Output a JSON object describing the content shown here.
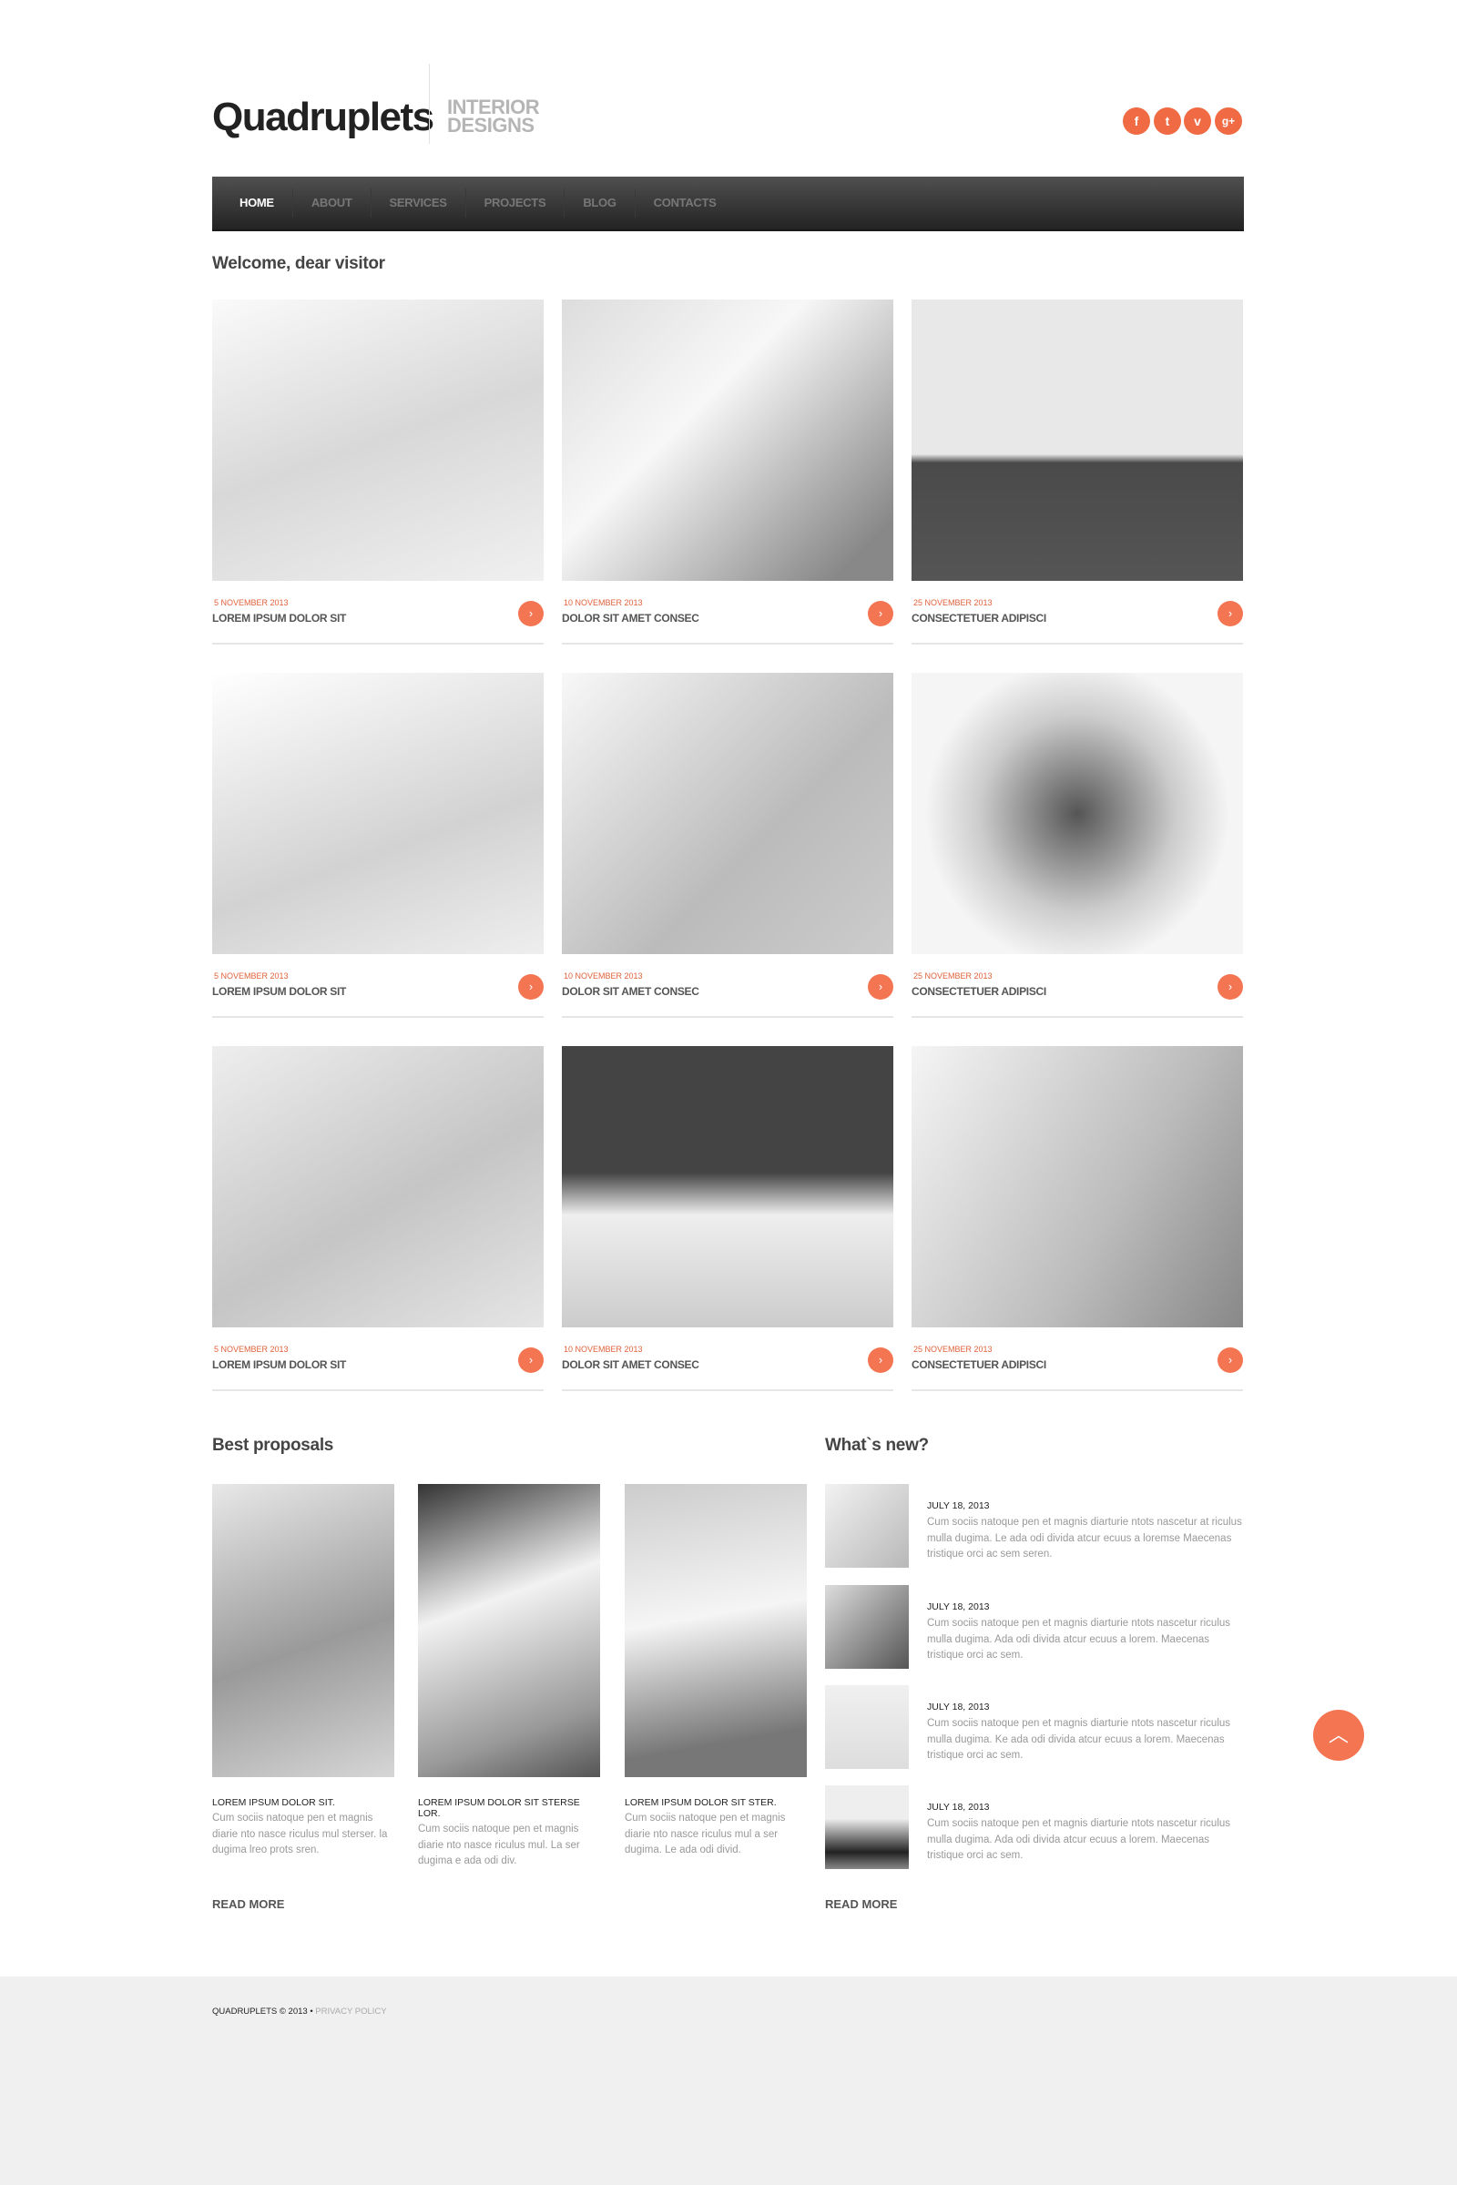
{
  "header": {
    "logo": "Quadruplets",
    "tagline_line1": "INTERIOR",
    "tagline_line2": "DESIGNS",
    "social": [
      {
        "icon": "facebook-icon",
        "glyph": "f"
      },
      {
        "icon": "twitter-icon",
        "glyph": "t"
      },
      {
        "icon": "vimeo-icon",
        "glyph": "v"
      },
      {
        "icon": "google-plus-icon",
        "glyph": "g+"
      }
    ]
  },
  "nav": {
    "items": [
      "HOME",
      "ABOUT",
      "SERVICES",
      "PROJECTS",
      "BLOG",
      "CONTACTS"
    ],
    "active": "HOME"
  },
  "welcome": {
    "title": "Welcome, dear visitor",
    "cards": [
      {
        "date": "5 NOVEMBER 2013",
        "title": "LOREM IPSUM DOLOR SIT"
      },
      {
        "date": "10 NOVEMBER 2013",
        "title": "DOLOR SIT AMET CONSEC"
      },
      {
        "date": "25 NOVEMBER 2013",
        "title": "CONSECTETUER ADIPISCI"
      },
      {
        "date": "5 NOVEMBER 2013",
        "title": "LOREM IPSUM DOLOR SIT"
      },
      {
        "date": "10 NOVEMBER 2013",
        "title": "DOLOR SIT AMET CONSEC"
      },
      {
        "date": "25 NOVEMBER 2013",
        "title": "CONSECTETUER ADIPISCI"
      },
      {
        "date": "5 NOVEMBER 2013",
        "title": "LOREM IPSUM DOLOR SIT"
      },
      {
        "date": "10 NOVEMBER 2013",
        "title": "DOLOR SIT AMET CONSEC"
      },
      {
        "date": "25 NOVEMBER 2013",
        "title": "CONSECTETUER ADIPISCI"
      }
    ],
    "arrow": "›"
  },
  "proposals": {
    "title": "Best proposals",
    "read_more": "READ MORE",
    "items": [
      {
        "title": "LOREM IPSUM DOLOR SIT.",
        "text": "Cum sociis natoque pen et magnis diarie nto nasce riculus mul sterser. la dugima lreo prots sren."
      },
      {
        "title": "LOREM IPSUM DOLOR SIT STERSE LOR.",
        "text": "Cum sociis natoque pen et magnis diarie nto nasce riculus mul. La ser dugima e ada odi div."
      },
      {
        "title": "LOREM IPSUM DOLOR SIT STER.",
        "text": "Cum sociis natoque pen et magnis diarie nto nasce riculus mul a ser dugima. Le ada odi divid."
      }
    ]
  },
  "news": {
    "title": "What`s new?",
    "read_more": "READ MORE",
    "items": [
      {
        "date": "JULY 18, 2013",
        "text": "Cum sociis natoque pen et magnis diarturie ntots nascetur at riculus mulla dugima. Le ada odi divida atcur ecuus a loremse Maecenas tristique orci ac sem seren."
      },
      {
        "date": "JULY 18, 2013",
        "text": "Cum sociis natoque pen et magnis diarturie ntots nascetur riculus mulla dugima. Ada odi divida atcur ecuus a lorem. Maecenas tristique orci ac sem."
      },
      {
        "date": "JULY 18, 2013",
        "text": "Cum sociis natoque pen et magnis diarturie ntots nascetur riculus mulla dugima. Ke ada odi divida atcur ecuus a lorem. Maecenas tristique orci ac sem."
      },
      {
        "date": "JULY 18, 2013",
        "text": "Cum sociis natoque pen et magnis diarturie ntots nascetur riculus mulla dugima. Ada odi divida atcur ecuus a lorem. Maecenas tristique orci ac sem."
      }
    ]
  },
  "back_to_top": "︿",
  "footer": {
    "copyright": "QUADRUPLETS © 2013 • ",
    "privacy": "PRIVACY POLICY"
  },
  "colors": {
    "accent": "#f47552",
    "nav_dark": "#2a2a2a",
    "footer_bg": "#f0f0f0"
  }
}
